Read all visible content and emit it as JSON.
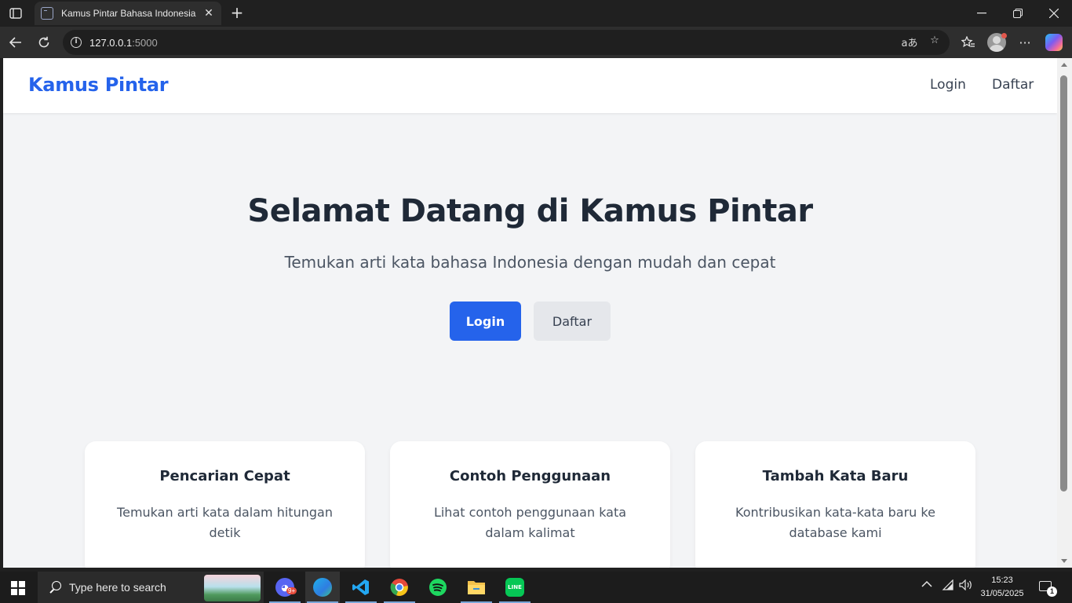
{
  "browser": {
    "tab_title": "Kamus Pintar Bahasa Indonesia",
    "url_host": "127.0.0.1",
    "url_rest": ":5000"
  },
  "navbar": {
    "brand": "Kamus Pintar",
    "links": [
      "Login",
      "Daftar"
    ]
  },
  "hero": {
    "title": "Selamat Datang di Kamus Pintar",
    "subtitle": "Temukan arti kata bahasa Indonesia dengan mudah dan cepat",
    "primary_button": "Login",
    "secondary_button": "Daftar"
  },
  "features": [
    {
      "title": "Pencarian Cepat",
      "text": "Temukan arti kata dalam hitungan detik"
    },
    {
      "title": "Contoh Penggunaan",
      "text": "Lihat contoh penggunaan kata dalam kalimat"
    },
    {
      "title": "Tambah Kata Baru",
      "text": "Kontribusikan kata-kata baru ke database kami"
    }
  ],
  "taskbar": {
    "search_placeholder": "Type here to search",
    "time": "15:23",
    "date": "31/05/2025",
    "notification_count": "1",
    "discord_badge": "9+"
  },
  "colors": {
    "brand": "#2563eb",
    "page_bg": "#f3f4f6",
    "heading": "#1f2937"
  }
}
